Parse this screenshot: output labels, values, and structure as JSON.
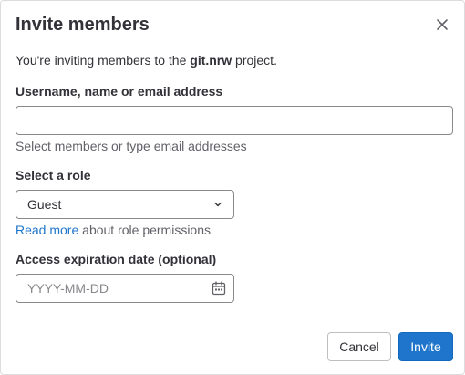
{
  "modal": {
    "title": "Invite members",
    "intro_prefix": "You're inviting members to the ",
    "project_name": "git.nrw",
    "intro_suffix": " project."
  },
  "username_field": {
    "label": "Username, name or email address",
    "value": "",
    "help": "Select members or type email addresses"
  },
  "role": {
    "label": "Select a role",
    "selected": "Guest",
    "read_more_link": "Read more",
    "read_more_suffix": " about role permissions"
  },
  "expiration": {
    "label": "Access expiration date (optional)",
    "placeholder": "YYYY-MM-DD"
  },
  "buttons": {
    "cancel": "Cancel",
    "invite": "Invite"
  },
  "icons": {
    "close": "close-icon",
    "chevron": "chevron-down-icon",
    "calendar": "calendar-icon"
  },
  "colors": {
    "primary": "#1f75cb",
    "text": "#333238",
    "muted": "#626168",
    "border": "#89888d"
  }
}
